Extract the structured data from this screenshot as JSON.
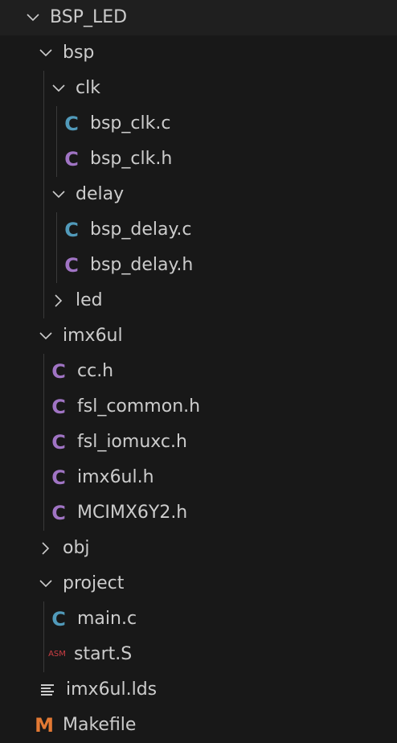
{
  "explorer": {
    "root": {
      "label": "BSP_LED"
    },
    "items": [
      {
        "label": "bsp",
        "kind": "folder-open"
      },
      {
        "label": "clk",
        "kind": "folder-open"
      },
      {
        "label": "bsp_clk.c",
        "kind": "c-source",
        "icon_glyph": "C"
      },
      {
        "label": "bsp_clk.h",
        "kind": "c-header",
        "icon_glyph": "C"
      },
      {
        "label": "delay",
        "kind": "folder-open"
      },
      {
        "label": "bsp_delay.c",
        "kind": "c-source",
        "icon_glyph": "C"
      },
      {
        "label": "bsp_delay.h",
        "kind": "c-header",
        "icon_glyph": "C"
      },
      {
        "label": "led",
        "kind": "folder-closed"
      },
      {
        "label": "imx6ul",
        "kind": "folder-open"
      },
      {
        "label": "cc.h",
        "kind": "c-header",
        "icon_glyph": "C"
      },
      {
        "label": "fsl_common.h",
        "kind": "c-header",
        "icon_glyph": "C"
      },
      {
        "label": "fsl_iomuxc.h",
        "kind": "c-header",
        "icon_glyph": "C"
      },
      {
        "label": "imx6ul.h",
        "kind": "c-header",
        "icon_glyph": "C"
      },
      {
        "label": "MCIMX6Y2.h",
        "kind": "c-header",
        "icon_glyph": "C"
      },
      {
        "label": "obj",
        "kind": "folder-closed"
      },
      {
        "label": "project",
        "kind": "folder-open"
      },
      {
        "label": "main.c",
        "kind": "c-source",
        "icon_glyph": "C"
      },
      {
        "label": "start.S",
        "kind": "asm",
        "icon_glyph": "ASM"
      },
      {
        "label": "imx6ul.lds",
        "kind": "text-lines"
      },
      {
        "label": "Makefile",
        "kind": "makefile",
        "icon_glyph": "M"
      }
    ]
  },
  "colors": {
    "background": "#181818",
    "root_row": "#1f1f1f",
    "text": "#cccccc",
    "c_source_icon": "#519aba",
    "c_header_icon": "#a074c4",
    "asm_icon": "#cc3e44",
    "makefile_icon": "#e37933",
    "indent_guide": "#3a3a3a"
  }
}
